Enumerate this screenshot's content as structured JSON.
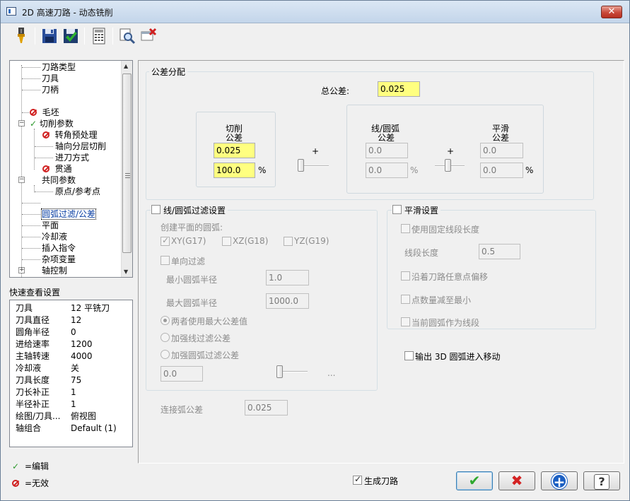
{
  "window": {
    "title": "2D 高速刀路 - 动态铣削",
    "close_label": "✕"
  },
  "toolbar": {
    "icons": [
      "tool-icon",
      "save-icon",
      "save-green-icon",
      "calculator-icon",
      "preview-icon",
      "delete-icon"
    ]
  },
  "tree": {
    "items": [
      "刀路类型",
      "刀具",
      "刀柄",
      "毛坯",
      "切削参数",
      "转角预处理",
      "轴向分层切削",
      "进刀方式",
      "贯通",
      "共同参数",
      "原点/参考点",
      "圆弧过滤/公差",
      "平面",
      "冷却液",
      "插入指令",
      "杂项变量",
      "轴控制"
    ]
  },
  "quick_view": {
    "label": "快速查看设置",
    "rows": [
      {
        "k": "刀具",
        "v": "12 平铣刀"
      },
      {
        "k": "刀具直径",
        "v": "12"
      },
      {
        "k": "圆角半径",
        "v": "0"
      },
      {
        "k": "进给速率",
        "v": "1200"
      },
      {
        "k": "主轴转速",
        "v": "4000"
      },
      {
        "k": "冷却液",
        "v": "关"
      },
      {
        "k": "刀具长度",
        "v": "75"
      },
      {
        "k": "刀长补正",
        "v": "1"
      },
      {
        "k": "半径补正",
        "v": "1"
      },
      {
        "k": "绘图/刀具...",
        "v": "俯视图"
      },
      {
        "k": "轴组合",
        "v": "Default (1)"
      }
    ]
  },
  "legend": {
    "edit": "=编辑",
    "invalid": "=无效"
  },
  "tolerance": {
    "group_title": "公差分配",
    "total_label": "总公差:",
    "total_value": "0.025",
    "cut_label_1": "切削",
    "cut_label_2": "公差",
    "cut_value": "0.025",
    "cut_percent": "100.0",
    "line_arc_label_1": "线/圆弧",
    "line_arc_label_2": "公差",
    "line_arc_value": "0.0",
    "line_arc_percent": "0.0",
    "smooth_label_1": "平滑",
    "smooth_label_2": "公差",
    "smooth_value": "0.0",
    "smooth_percent": "0.0",
    "percent_sign": "%",
    "plus": "+"
  },
  "line_arc_filter": {
    "title": "线/圆弧过滤设置",
    "plane_label": "创建平面的圆弧:",
    "xy": "XY(G17)",
    "xz": "XZ(G18)",
    "yz": "YZ(G19)",
    "one_way": "单向过滤",
    "min_radius_label": "最小圆弧半径",
    "min_radius": "1.0",
    "max_radius_label": "最大圆弧半径",
    "max_radius": "1000.0",
    "opt_both": "两者使用最大公差值",
    "opt_line": "加强线过滤公差",
    "opt_arc": "加强圆弧过滤公差",
    "ratio_value": "0.0",
    "ellipsis": "..."
  },
  "smooth": {
    "title": "平滑设置",
    "fixed_len": "使用固定线段长度",
    "seg_len_label": "线段长度",
    "seg_len": "0.5",
    "offset_any": "沿着刀路任意点偏移",
    "min_points": "点数量减至最小",
    "arc_as_line": "当前圆弧作为线段"
  },
  "output_3d": "输出 3D 圆弧进入移动",
  "join_arc_label": "连接弧公差",
  "join_arc_value": "0.025",
  "gen_toolpath": "生成刀路",
  "buttons": {
    "ok": "✔",
    "cancel": "✖",
    "add": "+",
    "help": "?"
  }
}
